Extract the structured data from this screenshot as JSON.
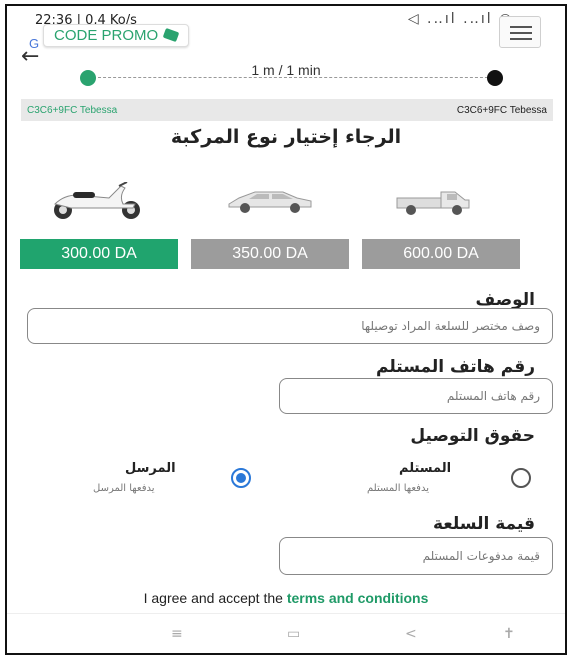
{
  "status_bar": {
    "time": "22:36 | 0,4 Ko/s",
    "icons": "◁ .‥ıl .‥ıl ◎ ▭"
  },
  "promo_banner": {
    "label": "CODE PROMO"
  },
  "route": {
    "duration": "1 m / 1 min",
    "from_address": "C3C6+9FC Tebessa",
    "to_address": "C3C6+9FC Tebessa"
  },
  "vehicle_section": {
    "title": "الرجاء إختيار نوع المركبة",
    "vehicles": [
      {
        "name": "motorcycle",
        "price": "300.00 DA",
        "selected": true
      },
      {
        "name": "car",
        "price": "350.00 DA",
        "selected": false
      },
      {
        "name": "pickup-truck",
        "price": "600.00 DA",
        "selected": false
      }
    ]
  },
  "form": {
    "description_label": "الوصف",
    "description_placeholder": "وصف مختصر للسلعة المراد توصيلها",
    "phone_label": "رقم هاتف المستلم",
    "phone_placeholder": "رقم هاتف المستلم",
    "delivery_rights_label": "حقوق التوصيل",
    "options": [
      {
        "title": "المرسل",
        "subtitle": "يدفعها المرسل",
        "checked": true
      },
      {
        "title": "المستلم",
        "subtitle": "يدفعها المستلم",
        "checked": false
      }
    ],
    "goods_value_label": "قيمة السلعة",
    "goods_value_placeholder": "قيمة مدفوعات المستلم"
  },
  "terms": {
    "prefix": "I agree and accept the",
    "link": "terms and conditions"
  },
  "nav_bar": {
    "menu_icon": "≡",
    "home_icon": "▭",
    "back_icon": "<",
    "accessibility_icon": "✝"
  },
  "colors": {
    "accent_green": "#20a46e",
    "inactive_gray": "#9c9c9c",
    "radio_blue": "#2a78d8"
  }
}
